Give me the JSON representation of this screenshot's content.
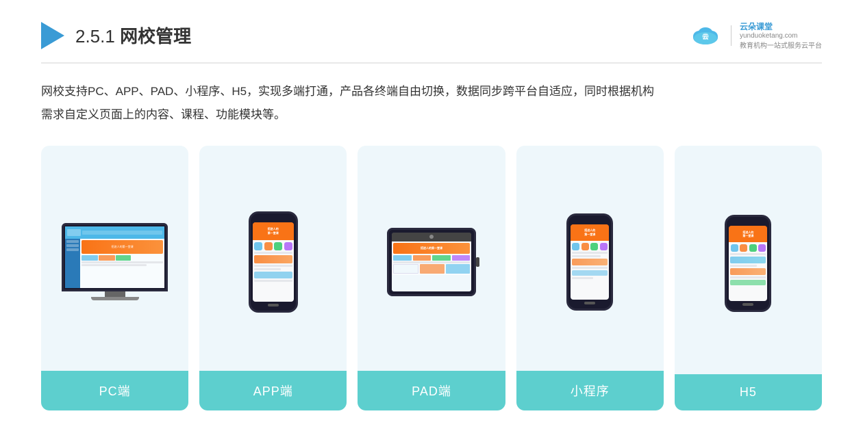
{
  "header": {
    "section_number": "2.5.1",
    "title": "网校管理",
    "logo_name": "云朵课堂",
    "logo_url": "yunduoketang.com",
    "logo_tagline": "教育机构一站式服务云平台"
  },
  "description": {
    "line1": "网校支持PC、APP、PAD、小程序、H5，实现多端打通，产品各终端自由切换，数据同步跨平台自适应，同时根据机构",
    "line2": "需求自定义页面上的内容、课程、功能模块等。"
  },
  "cards": [
    {
      "id": "pc",
      "label": "PC端",
      "type": "pc"
    },
    {
      "id": "app",
      "label": "APP端",
      "type": "phone"
    },
    {
      "id": "pad",
      "label": "PAD端",
      "type": "tablet"
    },
    {
      "id": "miniprogram",
      "label": "小程序",
      "type": "phone"
    },
    {
      "id": "h5",
      "label": "H5",
      "type": "phone"
    }
  ],
  "colors": {
    "card_bg": "#eef7fb",
    "card_label_bg": "#5dcfce",
    "accent": "#4db8e8",
    "orange": "#f97316"
  }
}
